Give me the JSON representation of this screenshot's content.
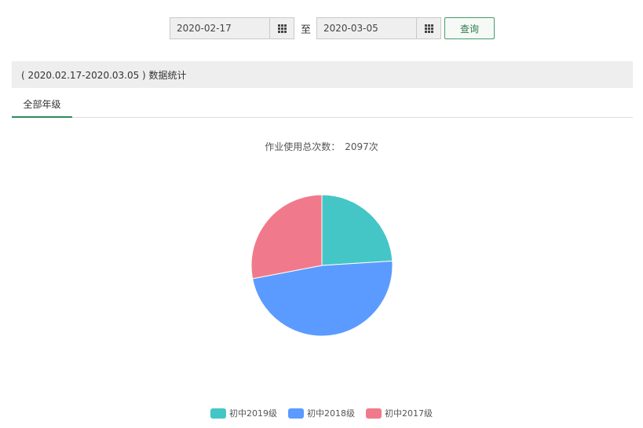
{
  "filter": {
    "start_date": "2020-02-17",
    "end_date": "2020-03-05",
    "separator": "至",
    "query_label": "查询"
  },
  "stats_bar": {
    "title": "( 2020.02.17-2020.03.05 ) 数据统计"
  },
  "tabs": [
    {
      "label": "全部年级",
      "active": true
    }
  ],
  "summary": {
    "label": "作业使用总次数：",
    "total": "2097次"
  },
  "chart_data": {
    "type": "pie",
    "categories": [
      "初中2019级",
      "初中2018级",
      "初中2017级"
    ],
    "values": [
      24,
      48,
      28
    ],
    "colors": [
      "#45c6c6",
      "#5b9bff",
      "#f07a8c"
    ],
    "legend_position": "bottom"
  }
}
